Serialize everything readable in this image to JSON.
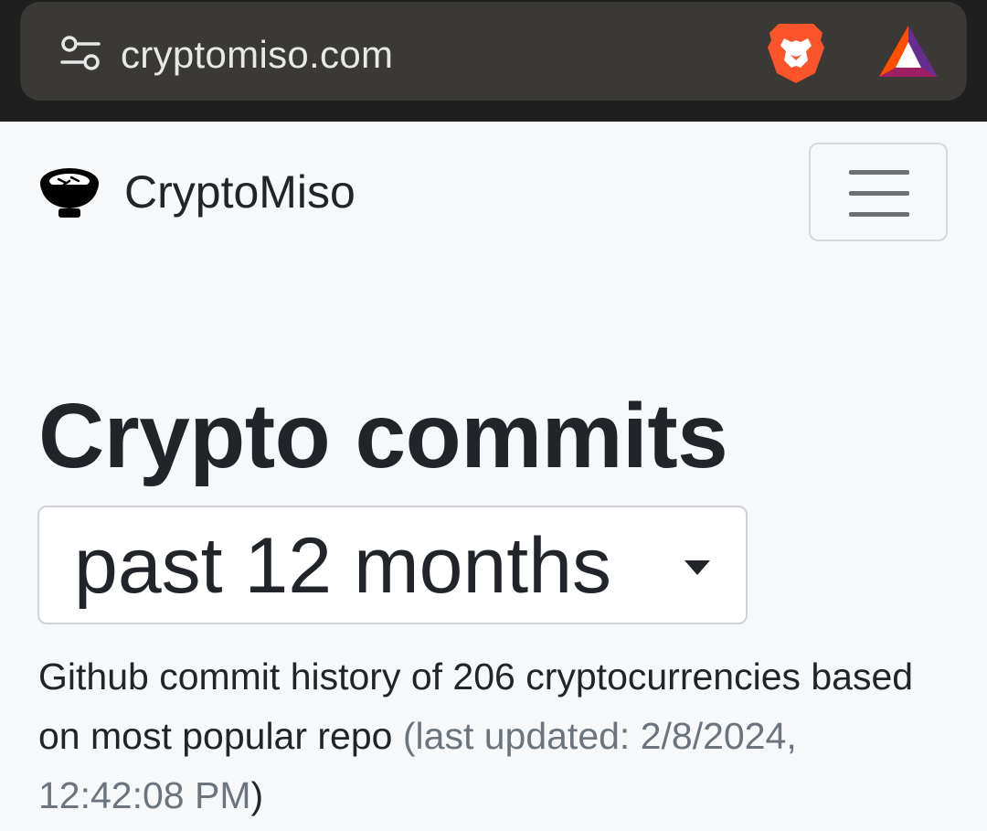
{
  "browser": {
    "url": "cryptomiso.com"
  },
  "navbar": {
    "brand": "CryptoMiso"
  },
  "main": {
    "title": "Crypto commits",
    "period": {
      "selected": "past 12 months"
    },
    "description": "Github commit history of 206 cryptocurrencies based on most popular repo",
    "updated_prefix": "(last updated: ",
    "updated_value": "2/8/2024, 12:42:08 PM",
    "updated_suffix": ")"
  },
  "colors": {
    "text": "#212529",
    "muted": "#6c757d",
    "page_bg": "#f7f8fa",
    "browser_bg": "#1f1f1f",
    "url_pill": "#3a3936"
  },
  "icons": {
    "site_settings": "tune-icon",
    "brave_shields": "brave-lion-icon",
    "brave_rewards": "bat-triangle-icon",
    "brand_logo": "miso-bowl-icon",
    "menu": "hamburger-icon",
    "dropdown": "caret-down-icon"
  }
}
